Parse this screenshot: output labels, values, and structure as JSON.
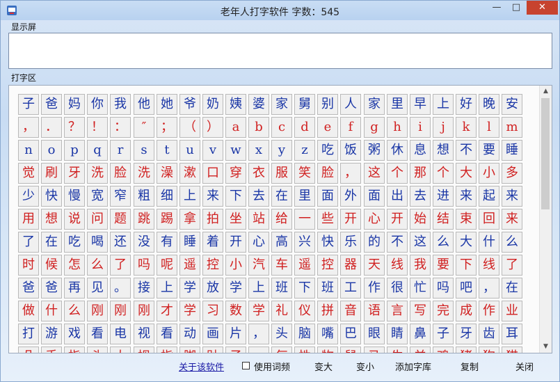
{
  "window": {
    "title": "老年人打字软件  字数：545",
    "min_glyph": "—",
    "max_glyph": "□",
    "close_glyph": "✕"
  },
  "display": {
    "label": "显示屏",
    "text": ""
  },
  "typing": {
    "label": "打字区"
  },
  "colors": {
    "red_key": "#d02020",
    "blue_key": "#1a36a6"
  },
  "keyboard_rows": [
    {
      "color": "blue",
      "keys": [
        "子",
        "爸",
        "妈",
        "你",
        "我",
        "他",
        "她",
        "爷",
        "奶",
        "姨",
        "婆",
        "家",
        "舅",
        "别",
        "人",
        "家",
        "里",
        "早",
        "上",
        "好",
        "晚",
        "安"
      ]
    },
    {
      "color": "red",
      "keys": [
        "，",
        "．",
        "？",
        "！",
        "：",
        "″",
        "；",
        "（",
        "）",
        "a",
        "b",
        "c",
        "d",
        "e",
        "f",
        "g",
        "h",
        "i",
        "j",
        "k",
        "l",
        "m"
      ]
    },
    {
      "color": "blue",
      "keys": [
        "n",
        "o",
        "p",
        "q",
        "r",
        "s",
        "t",
        "u",
        "v",
        "w",
        "x",
        "y",
        "z",
        "吃",
        "饭",
        "粥",
        "休",
        "息",
        "想",
        "不",
        "要",
        "睡"
      ]
    },
    {
      "color": "red",
      "keys": [
        "觉",
        "刷",
        "牙",
        "洗",
        "脸",
        "洗",
        "澡",
        "漱",
        "口",
        "穿",
        "衣",
        "服",
        "笑",
        "脸",
        "，",
        "这",
        "个",
        "那",
        "个",
        "大",
        "小",
        "多"
      ]
    },
    {
      "color": "blue",
      "keys": [
        "少",
        "快",
        "慢",
        "宽",
        "窄",
        "粗",
        "细",
        "上",
        "来",
        "下",
        "去",
        "在",
        "里",
        "面",
        "外",
        "面",
        "出",
        "去",
        "进",
        "来",
        "起",
        "来"
      ]
    },
    {
      "color": "red",
      "keys": [
        "用",
        "想",
        "说",
        "问",
        "题",
        "跳",
        "踢",
        "拿",
        "拍",
        "坐",
        "站",
        "给",
        "一",
        "些",
        "开",
        "心",
        "开",
        "始",
        "结",
        "束",
        "回",
        "来"
      ]
    },
    {
      "color": "blue",
      "keys": [
        "了",
        "在",
        "吃",
        "喝",
        "还",
        "没",
        "有",
        "睡",
        "着",
        "开",
        "心",
        "高",
        "兴",
        "快",
        "乐",
        "的",
        "不",
        "这",
        "么",
        "大",
        "什",
        "么"
      ]
    },
    {
      "color": "red",
      "keys": [
        "时",
        "候",
        "怎",
        "么",
        "了",
        "吗",
        "呢",
        "遥",
        "控",
        "小",
        "汽",
        "车",
        "遥",
        "控",
        "器",
        "天",
        "线",
        "我",
        "要",
        "下",
        "线",
        "了"
      ]
    },
    {
      "color": "blue",
      "keys": [
        "爸",
        "爸",
        "再",
        "见",
        "。",
        "接",
        "上",
        "学",
        "放",
        "学",
        "上",
        "班",
        "下",
        "班",
        "工",
        "作",
        "很",
        "忙",
        "吗",
        "吧",
        "，",
        "在"
      ]
    },
    {
      "color": "red",
      "keys": [
        "做",
        "什",
        "么",
        "刚",
        "刚",
        "刚",
        "才",
        "学",
        "习",
        "数",
        "学",
        "礼",
        "仪",
        "拼",
        "音",
        "语",
        "言",
        "写",
        "完",
        "成",
        "作",
        "业"
      ]
    },
    {
      "color": "blue",
      "keys": [
        "打",
        "游",
        "戏",
        "看",
        "电",
        "视",
        "看",
        "动",
        "画",
        "片",
        "，",
        "头",
        "脑",
        "嘴",
        "巴",
        "眼",
        "睛",
        "鼻",
        "子",
        "牙",
        "齿",
        "耳"
      ]
    },
    {
      "color": "red",
      "keys": [
        "朵",
        "手",
        "指",
        "头",
        "大",
        "拇",
        "指",
        "脚",
        "趾",
        "子",
        "。",
        "每",
        "性",
        "物",
        "鼠",
        "马",
        "牛",
        "羊",
        "鸡",
        "猪",
        "狗",
        "猫"
      ]
    }
  ],
  "scrollbar": {
    "up_glyph": "▲",
    "down_glyph": "▼"
  },
  "toolbar": {
    "about": "关于该软件",
    "use_phrases": "使用词频",
    "bigger": "变大",
    "smaller": "变小",
    "add_lib": "添加字库",
    "copy": "复制",
    "close": "关闭"
  }
}
